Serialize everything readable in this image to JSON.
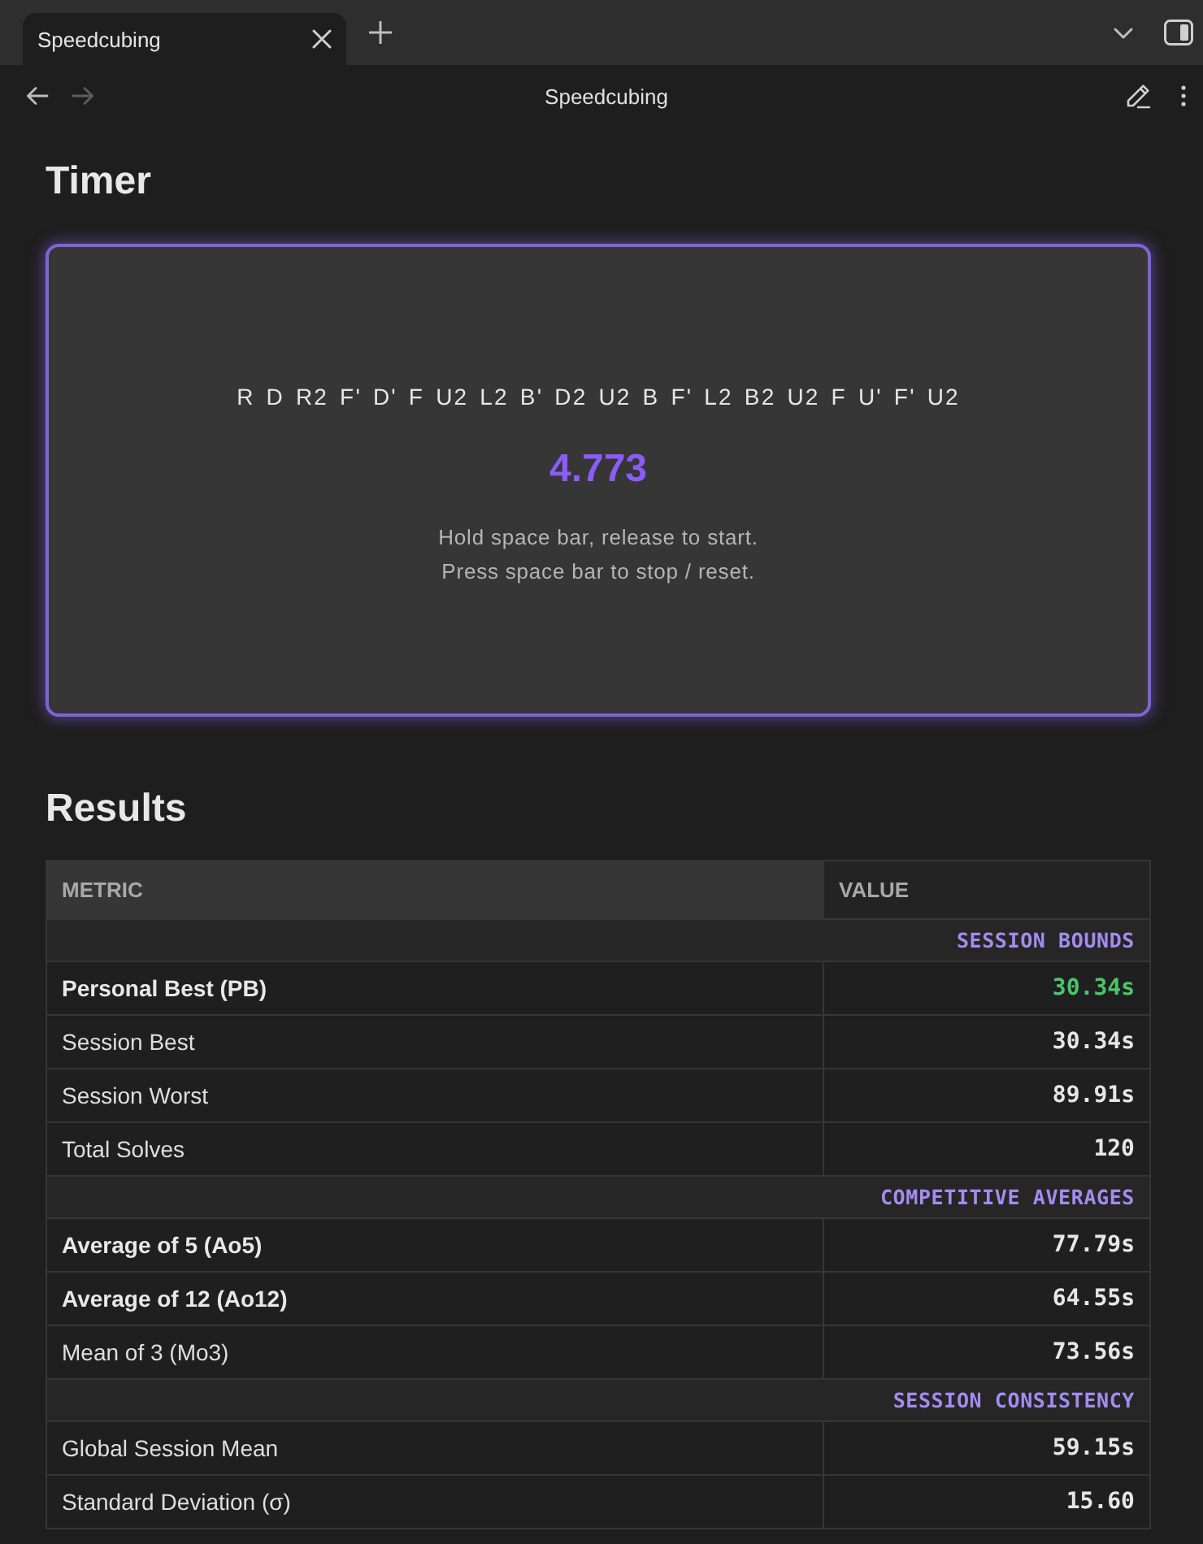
{
  "tabs": [
    {
      "label": "Speedcubing",
      "selected": true
    }
  ],
  "navigation": {
    "back": {
      "disabled": false
    },
    "forward": {
      "disabled": true
    },
    "title": "Speedcubing"
  },
  "timer": {
    "heading": "Timer",
    "scramble": "R D R2 F' D' F U2 L2 B' D2 U2 B F' L2 B2 U2 F U' F' U2",
    "time": "4.773",
    "hints": [
      "Hold space bar, release to start.",
      "Press space bar to stop / reset."
    ]
  },
  "results": {
    "heading": "Results",
    "columns": [
      "METRIC",
      "VALUE"
    ],
    "rows": [
      {
        "kind": "section",
        "label": "SESSION BOUNDS"
      },
      {
        "kind": "metric",
        "metric": "Personal Best (PB)",
        "value": "30.34s",
        "bold": true,
        "highlighted": true
      },
      {
        "kind": "metric",
        "metric": "Session Best",
        "value": "30.34s",
        "bold": false,
        "highlighted": false
      },
      {
        "kind": "metric",
        "metric": "Session Worst",
        "value": "89.91s",
        "bold": false,
        "highlighted": false
      },
      {
        "kind": "metric",
        "metric": "Total Solves",
        "value": "120",
        "bold": false,
        "highlighted": false
      },
      {
        "kind": "section",
        "label": "COMPETITIVE AVERAGES"
      },
      {
        "kind": "metric",
        "metric": "Average of 5 (Ao5)",
        "value": "77.79s",
        "bold": true,
        "highlighted": false
      },
      {
        "kind": "metric",
        "metric": "Average of 12 (Ao12)",
        "value": "64.55s",
        "bold": true,
        "highlighted": false
      },
      {
        "kind": "metric",
        "metric": "Mean of 3 (Mo3)",
        "value": "73.56s",
        "bold": false,
        "highlighted": false
      },
      {
        "kind": "section",
        "label": "SESSION CONSISTENCY"
      },
      {
        "kind": "metric",
        "metric": "Global Session Mean",
        "value": "59.15s",
        "bold": false,
        "highlighted": false
      },
      {
        "kind": "metric",
        "metric": "Standard Deviation (σ)",
        "value": "15.60",
        "bold": false,
        "highlighted": false
      }
    ]
  }
}
